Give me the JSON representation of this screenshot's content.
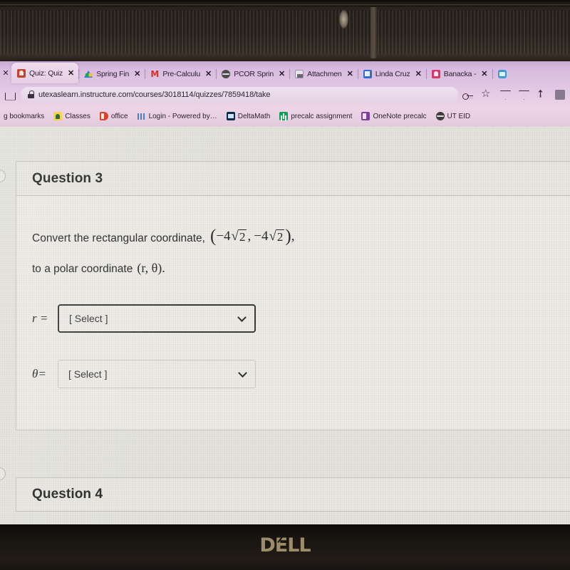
{
  "device": {
    "brand_logo": "DELL",
    "brand_logo_pre": "D",
    "brand_logo_mid": "E",
    "brand_logo_post": "LL"
  },
  "browser": {
    "tabs": [
      {
        "title": "Quiz: Quiz",
        "icon": "canvas-icon",
        "active": true,
        "close": "✕"
      },
      {
        "title": "Spring Fin",
        "icon": "google-drive-icon",
        "active": false,
        "close": "✕"
      },
      {
        "title": "Pre-Calculu",
        "icon": "gmail-icon",
        "active": false,
        "close": "✕"
      },
      {
        "title": "PCOR Sprin",
        "icon": "globe-icon",
        "active": false,
        "close": "✕"
      },
      {
        "title": "Attachmen",
        "icon": "document-icon",
        "active": false,
        "close": "✕"
      },
      {
        "title": "Linda Cruz",
        "icon": "blue-doc-icon",
        "active": false,
        "close": "✕"
      },
      {
        "title": "Banacka -",
        "icon": "pink-canvas-icon",
        "active": false,
        "close": "✕"
      }
    ],
    "leftmost_close": "✕",
    "address": {
      "url": "utexaslearn.instructure.com/courses/3018114/quizzes/7859418/take",
      "lock": "lock-icon"
    },
    "toolbar_icons": [
      "key-icon",
      "star-icon",
      "shield-icon",
      "shield-icon",
      "pin-icon",
      "extension-icon"
    ],
    "bookmarks": [
      {
        "label": "g bookmarks",
        "icon": "folder-icon"
      },
      {
        "label": "Classes",
        "icon": "google-classroom-icon"
      },
      {
        "label": "office",
        "icon": "microsoft-office-icon"
      },
      {
        "label": "Login - Powered by…",
        "icon": "login-icon"
      },
      {
        "label": "DeltaMath",
        "icon": "deltamath-icon"
      },
      {
        "label": "precalc assignment",
        "icon": "google-sheets-icon"
      },
      {
        "label": "OneNote precalc",
        "icon": "onenote-icon"
      },
      {
        "label": "UT EID",
        "icon": "ut-eid-icon"
      }
    ]
  },
  "quiz": {
    "question": {
      "heading": "Question 3",
      "prompt_lead": "Convert the rectangular coordinate,",
      "coordinate": {
        "open": "(",
        "x_sign": "−",
        "x_coeff": "4",
        "x_radical": "√",
        "x_radicand": "2",
        "comma": ",",
        "y_sign": "−",
        "y_coeff": "4",
        "y_radical": "√",
        "y_radicand": "2",
        "close": ")",
        "trailing": ","
      },
      "prompt_tail": "to a polar coordinate",
      "polar_pair": "(r, θ).",
      "fields": [
        {
          "label": "r =",
          "value": "[ Select ]",
          "state": "focused",
          "caret": "chevron-down-icon"
        },
        {
          "label": "θ=",
          "value": "[ Select ]",
          "state": "plain",
          "caret": "chevron-down-icon"
        }
      ]
    },
    "next_question": {
      "heading": "Question 4"
    }
  },
  "colors": {
    "page_bg": "#e4e3dd",
    "card_bg": "#eceae4",
    "card_border": "#c6c5bd",
    "chrome_purple": "#e3c9e4",
    "bezel": "#2e2721",
    "dell_gold": "#a89771",
    "focus_border": "#3b3b38"
  }
}
